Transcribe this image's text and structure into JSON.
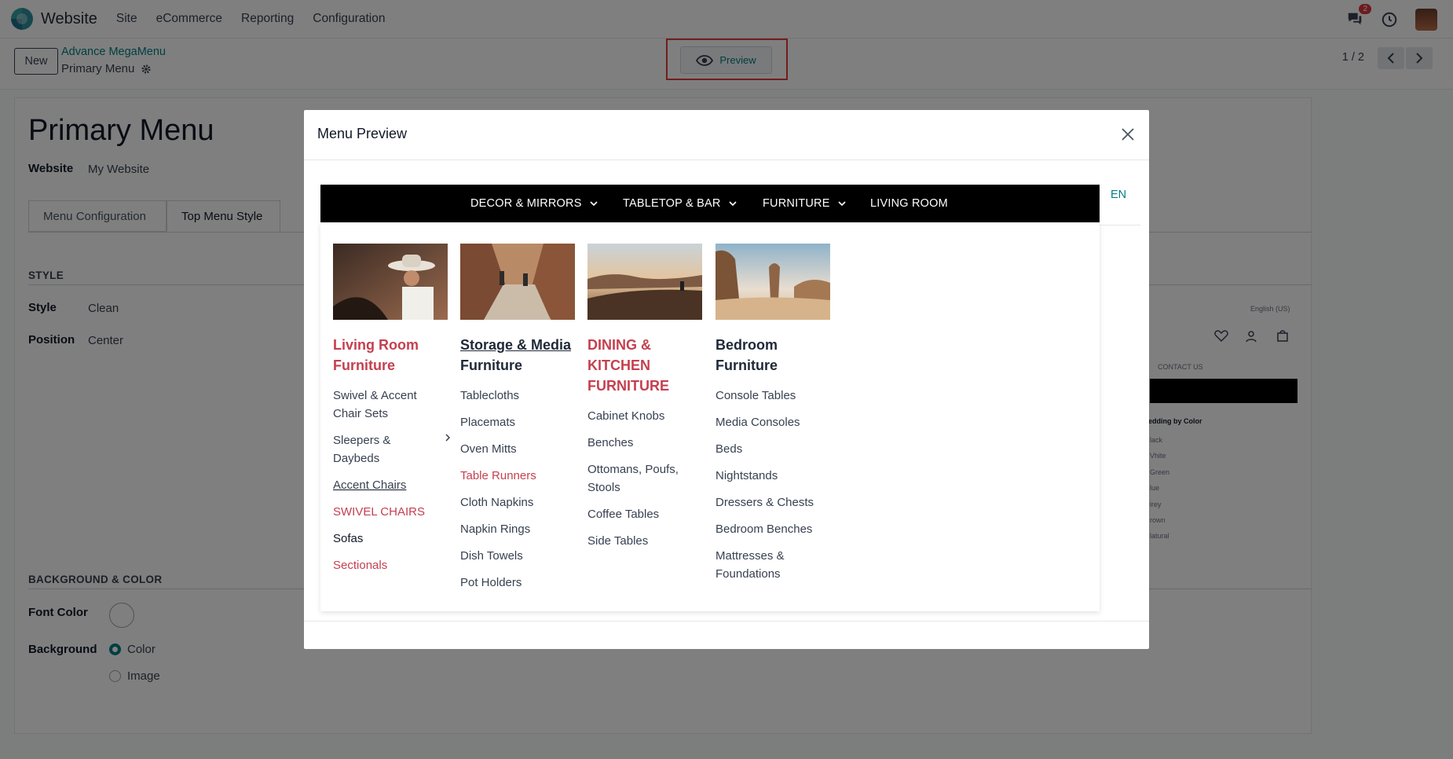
{
  "app": {
    "title": "Website"
  },
  "topnav": [
    "Site",
    "eCommerce",
    "Reporting",
    "Configuration"
  ],
  "notifications": {
    "count": "2"
  },
  "control_panel": {
    "new_label": "New",
    "breadcrumb_parent": "Advance MegaMenu",
    "breadcrumb_current": "Primary Menu",
    "preview_label": "Preview",
    "pager": "1 / 2"
  },
  "form": {
    "title": "Primary Menu",
    "website_label": "Website",
    "website_value": "My Website",
    "tabs": [
      "Menu Configuration",
      "Top Menu Style"
    ],
    "style_section": "STYLE",
    "style_label": "Style",
    "style_value": "Clean",
    "position_label": "Position",
    "position_value": "Center",
    "bg_section": "BACKGROUND & COLOR",
    "font_color_label": "Font Color",
    "background_label": "Background",
    "bg_options": [
      "Color",
      "Image"
    ],
    "bg_selected": "Color"
  },
  "bg_preview": {
    "lang": "English (US)",
    "contact": "CONTACT US",
    "filter_title": "edding by Color",
    "colors": [
      "lack",
      "Vhite",
      "Green",
      "lue",
      "irey",
      "rown",
      "latural"
    ]
  },
  "modal": {
    "title": "Menu Preview",
    "lang": "EN",
    "menu": [
      "DECOR & MIRRORS",
      "TABLETOP & BAR",
      "FURNITURE",
      "LIVING ROOM"
    ],
    "columns": [
      {
        "heading": [
          "Living Room",
          "Furniture"
        ],
        "items": [
          "Swivel & Accent Chair Sets",
          "Sleepers & Daybeds",
          "Accent Chairs",
          "SWIVEL CHAIRS",
          "Sofas",
          "Sectionals"
        ]
      },
      {
        "heading": [
          "Storage & Media",
          "Furniture"
        ],
        "items": [
          "Tablecloths",
          "Placemats",
          "Oven Mitts",
          "Table Runners",
          "Cloth Napkins",
          "Napkin Rings",
          "Dish Towels",
          "Pot Holders"
        ]
      },
      {
        "heading": [
          "DINING &",
          "KITCHEN",
          "FURNITURE"
        ],
        "items": [
          "Cabinet Knobs",
          "Benches",
          "Ottomans, Poufs, Stools",
          "Coffee Tables",
          "Side Tables"
        ]
      },
      {
        "heading": [
          "Bedroom",
          "Furniture"
        ],
        "items": [
          "Console Tables",
          "Media Consoles",
          "Beds",
          "Nightstands",
          "Dressers & Chests",
          "Bedroom Benches",
          "Mattresses & Foundations"
        ]
      }
    ]
  }
}
